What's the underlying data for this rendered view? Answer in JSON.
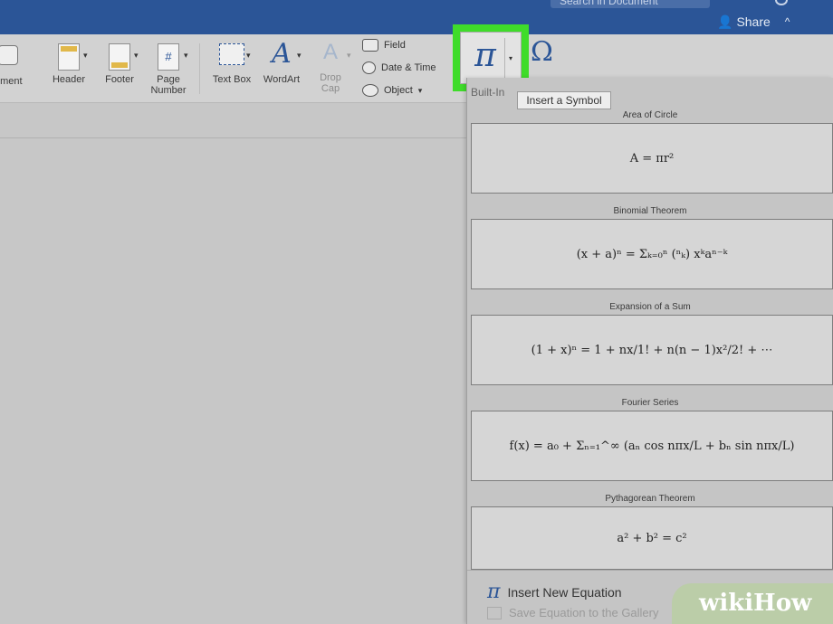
{
  "titlebar": {
    "search_placeholder": "Search in Document",
    "share_label": "Share",
    "share_caret": "^"
  },
  "ribbon": {
    "comment_label": "nment",
    "header_label": "Header",
    "footer_label": "Footer",
    "page_number_label_1": "Page",
    "page_number_label_2": "Number",
    "text_box_label": "Text Box",
    "wordart_label": "WordArt",
    "drop_cap_label_1": "Drop",
    "drop_cap_label_2": "Cap",
    "field_label": "Field",
    "date_time_label": "Date & Time",
    "object_label": "Object",
    "dropdown_glyph": "▾",
    "pi_glyph": "π",
    "omega_glyph": "Ω",
    "wordart_glyph": "A"
  },
  "tooltip": "Insert a Symbol",
  "panel": {
    "section_label": "Built-In",
    "equations": [
      {
        "title": "Area of Circle",
        "formula": "A = πr²"
      },
      {
        "title": "Binomial Theorem",
        "formula": "(x + a)ⁿ = Σₖ₌₀ⁿ (ⁿₖ) xᵏaⁿ⁻ᵏ"
      },
      {
        "title": "Expansion of a Sum",
        "formula": "(1 + x)ⁿ = 1 + nx/1! + n(n − 1)x²/2! + ⋯"
      },
      {
        "title": "Fourier Series",
        "formula": "f(x) = a₀ + Σₙ₌₁^∞ (aₙ cos nπx/L + bₙ sin nπx/L)"
      },
      {
        "title": "Pythagorean Theorem",
        "formula": "a² + b² = c²"
      }
    ],
    "insert_new_label": "Insert New Equation",
    "save_label": "Save Equation to the Gallery"
  },
  "watermark": "wikiHow",
  "colors": {
    "titlebar": "#2b5597",
    "highlight": "#3fdc2a",
    "accent_icon": "#2b5597"
  }
}
